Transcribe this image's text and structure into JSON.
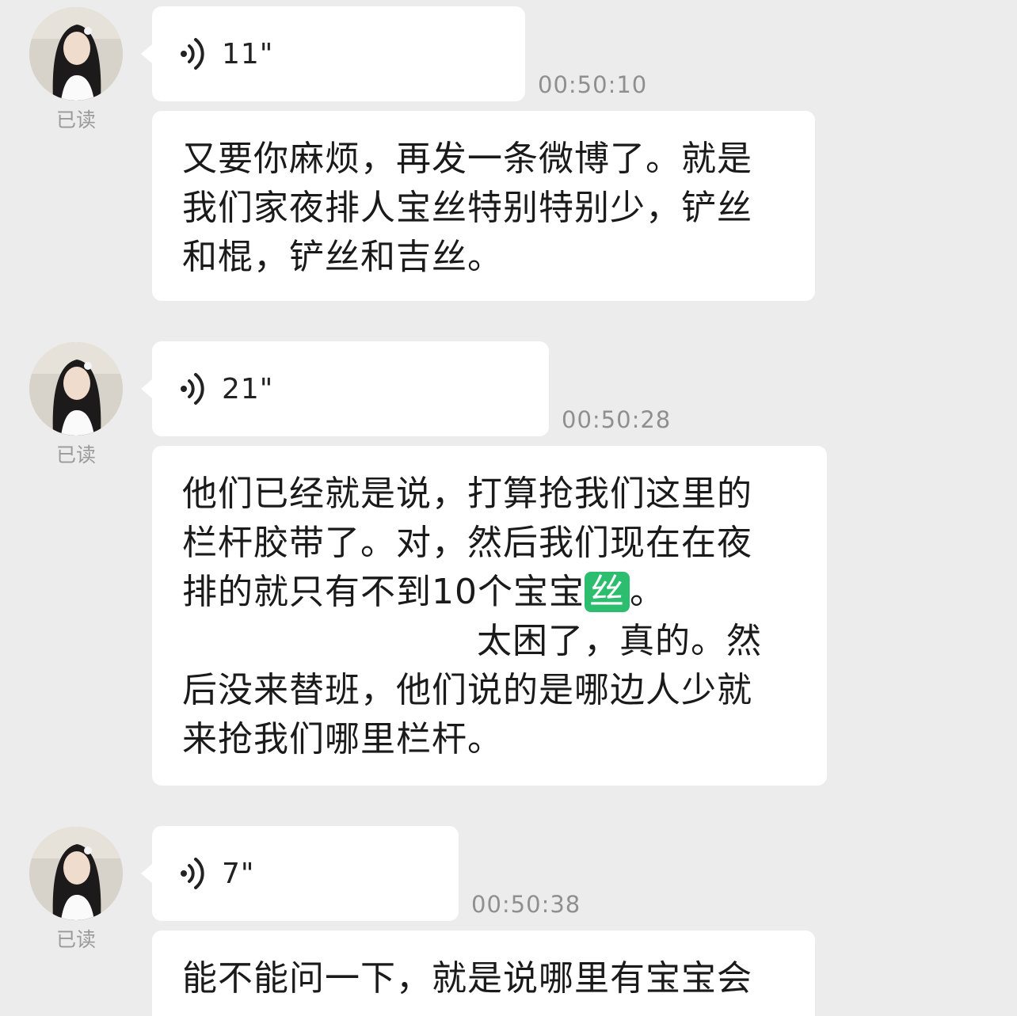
{
  "conversation": {
    "messages": [
      {
        "read_status": "已读",
        "voice_duration": "11\"",
        "time": "00:50:10",
        "transcript_lines": [
          "又要你麻烦，再发一条微博了。就是",
          "我们家夜排人宝丝特别特别少，铲丝",
          "和棍，铲丝和吉丝。"
        ]
      },
      {
        "read_status": "已读",
        "voice_duration": "21\"",
        "time": "00:50:28",
        "transcript_lines": [
          "他们已经就是说，打算抢我们这里的",
          "栏杆胶带了。对，然后我们现在在夜",
          "排的就只有不到10个宝宝",
          "太困了，真的。然",
          "后没来替班，他们说的是哪边人少就",
          "来抢我们哪里栏杆。"
        ],
        "highlight": "丝",
        "line3_end": "。"
      },
      {
        "read_status": "已读",
        "voice_duration": "7\"",
        "time": "00:50:38",
        "transcript_lines": [
          "能不能问一下，就是说哪里有宝宝会"
        ]
      }
    ]
  },
  "colors": {
    "background": "#ececec",
    "bubble": "#ffffff",
    "highlight": "#2dbd6e",
    "timestamp": "#8f8f8f",
    "read_label": "#9a9a9a"
  },
  "icons": {
    "voice": "voice-wave-icon",
    "avatar": "avatar-photo"
  }
}
